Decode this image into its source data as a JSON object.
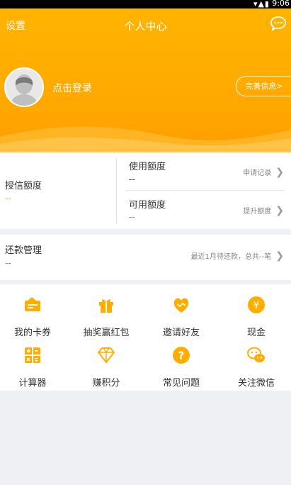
{
  "status": {
    "time": "9:06"
  },
  "header": {
    "settings": "设置",
    "title": "个人中心"
  },
  "profile": {
    "login": "点击登录",
    "complete": "完善信息>"
  },
  "credit": {
    "granted_label": "授信额度",
    "granted_value": "--",
    "used_label": "使用额度",
    "used_value": "--",
    "apply_link": "申请记录",
    "available_label": "可用额度",
    "available_value": "--",
    "raise_link": "提升额度"
  },
  "repay": {
    "label": "还款管理",
    "value": "--",
    "summary": "最近1月待还款，总共--笔"
  },
  "grid": {
    "items": [
      {
        "label": "我的卡券",
        "icon": "card-icon"
      },
      {
        "label": "抽奖赢红包",
        "icon": "gift-icon"
      },
      {
        "label": "邀请好友",
        "icon": "heart-handshake-icon"
      },
      {
        "label": "现金",
        "icon": "yen-icon"
      },
      {
        "label": "计算器",
        "icon": "calculator-icon"
      },
      {
        "label": "赚积分",
        "icon": "diamond-icon"
      },
      {
        "label": "常见问题",
        "icon": "question-icon"
      },
      {
        "label": "关注微信",
        "icon": "wechat-icon"
      }
    ]
  },
  "colors": {
    "accent": "#ffae00",
    "dash_orange": "#f5a623",
    "dash_blue": "#5b8def"
  }
}
